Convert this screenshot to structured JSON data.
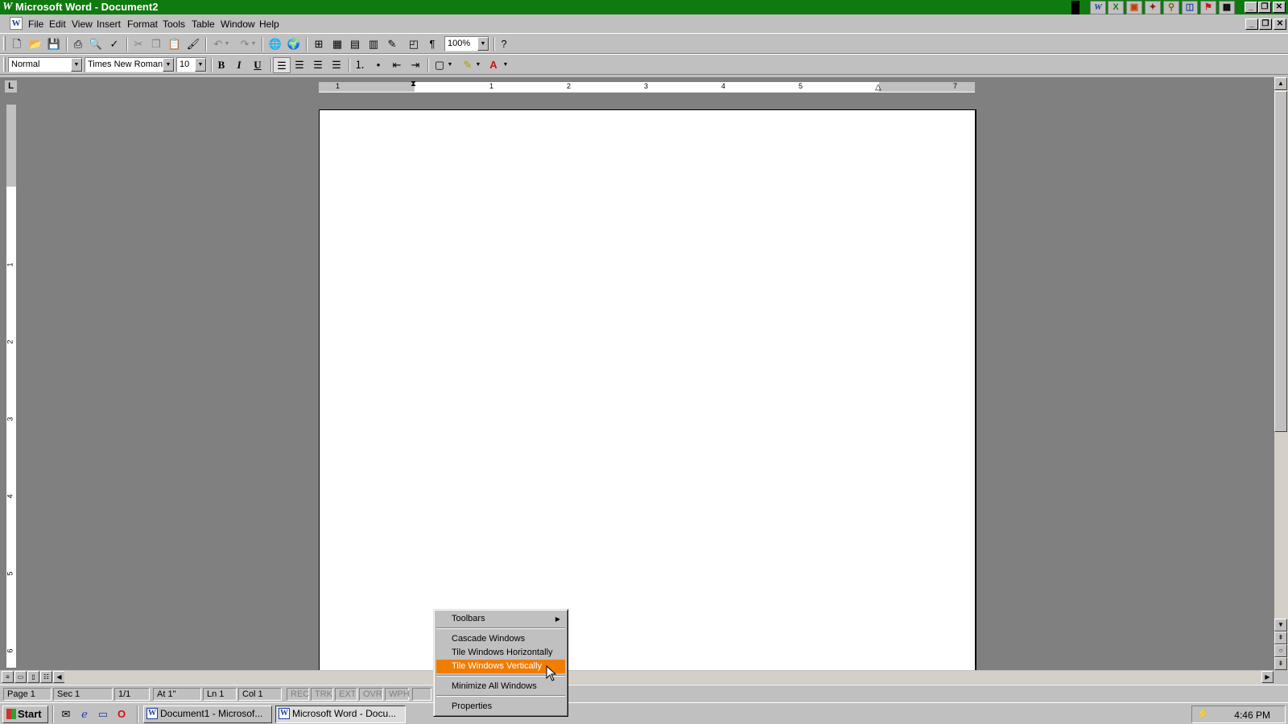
{
  "window": {
    "title": "Microsoft Word - Document2",
    "title_logo": "W",
    "bar_color": "#0f7a0f",
    "controls": {
      "minimize": "_",
      "restore": "❐",
      "close": "✕"
    }
  },
  "office_bar": {
    "icons": [
      "word-icon",
      "excel-icon",
      "powerpoint-icon",
      "access-icon",
      "binder-icon",
      "find-icon",
      "outlook-icon",
      "office-icon"
    ]
  },
  "menubar": {
    "items": [
      {
        "label": "File",
        "name": "menu-file"
      },
      {
        "label": "Edit",
        "name": "menu-edit"
      },
      {
        "label": "View",
        "name": "menu-view"
      },
      {
        "label": "Insert",
        "name": "menu-insert"
      },
      {
        "label": "Format",
        "name": "menu-format"
      },
      {
        "label": "Tools",
        "name": "menu-tools"
      },
      {
        "label": "Table",
        "name": "menu-table"
      },
      {
        "label": "Window",
        "name": "menu-window"
      },
      {
        "label": "Help",
        "name": "menu-help"
      }
    ]
  },
  "standard_toolbar": {
    "zoom": "100%"
  },
  "formatting_toolbar": {
    "style": "Normal",
    "font": "Times New Roman",
    "size": "10",
    "bold": "B",
    "italic": "I",
    "underline": "U"
  },
  "ruler": {
    "horizontal_numbers": [
      "1",
      "1",
      "2",
      "3",
      "4",
      "5",
      "7"
    ],
    "vertical_numbers": [
      "1",
      "2",
      "3",
      "4",
      "5",
      "6"
    ],
    "tab_selector": "L"
  },
  "statusbar": {
    "page": "Page 1",
    "section": "Sec 1",
    "pages": "1/1",
    "at": "At 1\"",
    "line": "Ln 1",
    "col": "Col 1",
    "rec": "REC",
    "trk": "TRK",
    "ext": "EXT",
    "ovr": "OVR",
    "wph": "WPH"
  },
  "taskbar": {
    "start_label": "Start",
    "tasks": [
      {
        "label": "Document1 - Microsof...",
        "active": false
      },
      {
        "label": "Microsoft Word - Docu...",
        "active": true
      }
    ],
    "clock": "4:46 PM"
  },
  "context_menu": {
    "items": [
      {
        "label": "Toolbars",
        "submenu": true,
        "highlight": false
      },
      {
        "label": "Cascade Windows",
        "submenu": false,
        "highlight": false
      },
      {
        "label": "Tile Windows Horizontally",
        "submenu": false,
        "highlight": false
      },
      {
        "label": "Tile Windows Vertically",
        "submenu": false,
        "highlight": true
      },
      {
        "label": "Minimize All Windows",
        "submenu": false,
        "highlight": false
      },
      {
        "label": "Properties",
        "submenu": false,
        "highlight": false
      }
    ],
    "highlight_color": "#f07c00"
  }
}
